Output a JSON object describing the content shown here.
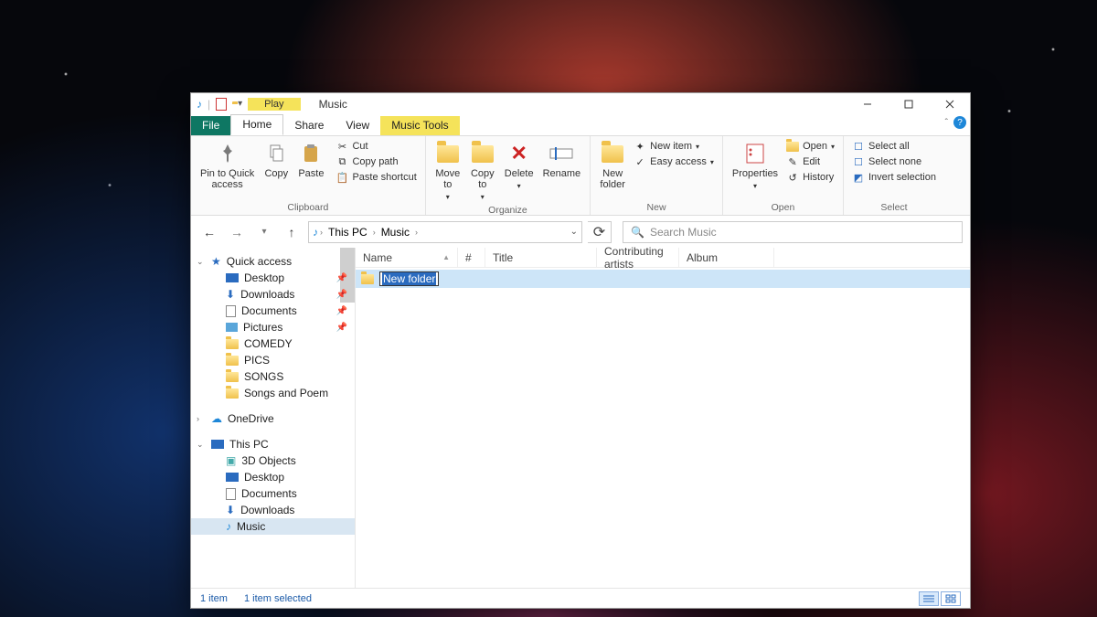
{
  "titlebar": {
    "context_tab": "Play",
    "title": "Music"
  },
  "tabs": {
    "file": "File",
    "home": "Home",
    "share": "Share",
    "view": "View",
    "music_tools": "Music Tools"
  },
  "ribbon": {
    "clipboard": {
      "label": "Clipboard",
      "pin": "Pin to Quick\naccess",
      "copy": "Copy",
      "paste": "Paste",
      "cut": "Cut",
      "copy_path": "Copy path",
      "paste_shortcut": "Paste shortcut"
    },
    "organize": {
      "label": "Organize",
      "move": "Move\nto",
      "copy": "Copy\nto",
      "delete": "Delete",
      "rename": "Rename"
    },
    "new": {
      "label": "New",
      "new_folder": "New\nfolder",
      "new_item": "New item",
      "easy_access": "Easy access"
    },
    "open": {
      "label": "Open",
      "properties": "Properties",
      "open": "Open",
      "edit": "Edit",
      "history": "History"
    },
    "select": {
      "label": "Select",
      "select_all": "Select all",
      "select_none": "Select none",
      "invert": "Invert selection"
    }
  },
  "address": {
    "root": "This PC",
    "folder": "Music",
    "search_placeholder": "Search Music"
  },
  "nav": {
    "quick_access": "Quick access",
    "items_qa": [
      "Desktop",
      "Downloads",
      "Documents",
      "Pictures",
      "COMEDY",
      "PICS",
      "SONGS",
      "Songs and Poem"
    ],
    "onedrive": "OneDrive",
    "this_pc": "This PC",
    "items_pc": [
      "3D Objects",
      "Desktop",
      "Documents",
      "Downloads",
      "Music"
    ]
  },
  "columns": {
    "name": "Name",
    "num": "#",
    "title": "Title",
    "artists": "Contributing artists",
    "album": "Album"
  },
  "list": {
    "new_folder": "New folder"
  },
  "status": {
    "count": "1 item",
    "selected": "1 item selected"
  },
  "colors": {
    "accent": "#0e7763",
    "select": "#cde5f8"
  }
}
